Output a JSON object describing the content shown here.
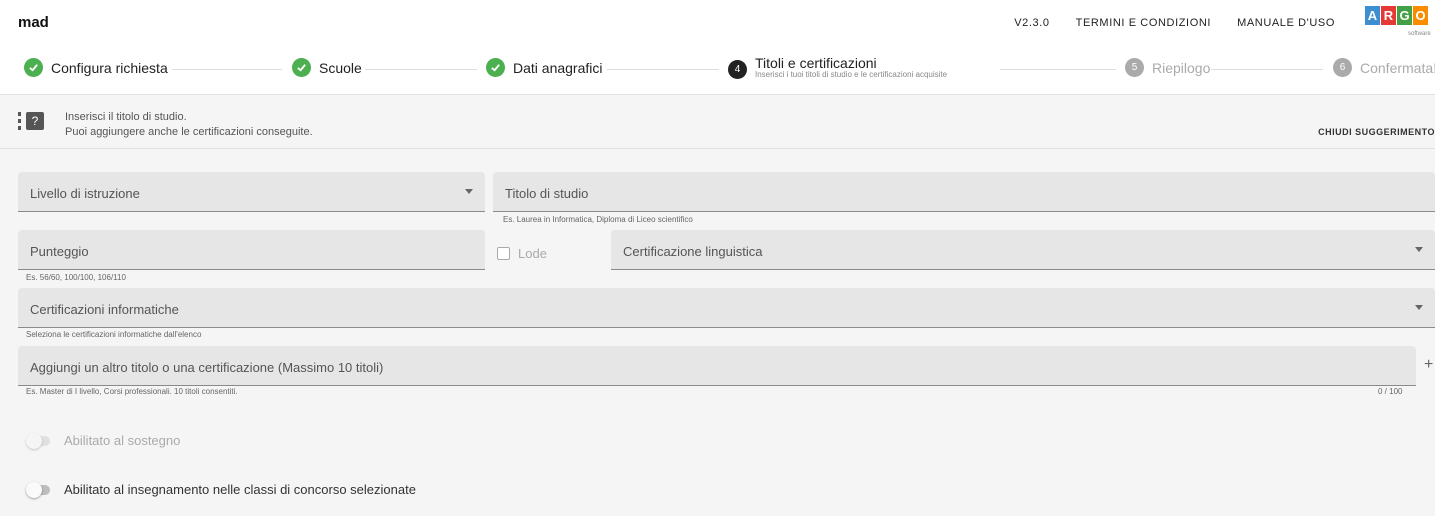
{
  "app": {
    "name": "mad"
  },
  "header": {
    "version": "V2.3.0",
    "links": [
      "TERMINI E CONDIZIONI",
      "MANUALE D'USO"
    ],
    "logo_letters": [
      "A",
      "R",
      "G",
      "O"
    ],
    "logo_colors": [
      "#3d8fd1",
      "#e53935",
      "#43a047",
      "#fb8c00"
    ],
    "logo_sub": "software"
  },
  "stepper": {
    "steps": [
      {
        "label": "Configura richiesta",
        "status": "done"
      },
      {
        "label": "Scuole",
        "status": "done"
      },
      {
        "label": "Dati anagrafici",
        "status": "done"
      },
      {
        "number": "4",
        "label": "Titoli e certificazioni",
        "sublabel": "Inserisci i tuoi titoli di studio e le certificazioni acquisite",
        "status": "active"
      },
      {
        "number": "5",
        "label": "Riepilogo",
        "status": "todo"
      },
      {
        "number": "6",
        "label": "Confermata!",
        "status": "todo"
      }
    ]
  },
  "hint": {
    "line1": "Inserisci il titolo di studio.",
    "line2": "Puoi aggiungere anche le certificazioni conseguite.",
    "close_label": "CHIUDI SUGGERIMENTO"
  },
  "form": {
    "livello_istruzione": {
      "label": "Livello di istruzione"
    },
    "titolo_studio": {
      "label": "Titolo di studio",
      "helper": "Es. Laurea in Informatica, Diploma di Liceo scientifico"
    },
    "punteggio": {
      "label": "Punteggio",
      "helper": "Es. 56/60, 100/100, 106/110"
    },
    "lode": {
      "label": "Lode"
    },
    "certificazione_linguistica": {
      "label": "Certificazione linguistica"
    },
    "certificazioni_informatiche": {
      "label": "Certificazioni informatiche",
      "helper": "Seleziona le certificazioni informatiche dall'elenco"
    },
    "altro_titolo": {
      "label": "Aggiungi un altro titolo o una certificazione (Massimo 10 titoli)",
      "helper": "Es. Master di I livello, Corsi professionali. 10 titoli consentiti.",
      "counter": "0 / 100"
    },
    "sostegno": {
      "label": "Abilitato al sostegno"
    },
    "insegnamento": {
      "label": "Abilitato al insegnamento nelle classi di concorso selezionate"
    }
  }
}
